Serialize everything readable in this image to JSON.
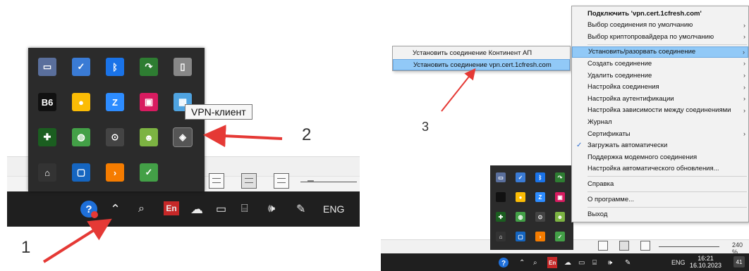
{
  "left": {
    "tray_icons": [
      {
        "name": "monitor-icon",
        "glyph": "▭",
        "color": "#5a6f9c"
      },
      {
        "name": "shield-check-icon",
        "glyph": "✓",
        "color": "#3a7bd5"
      },
      {
        "name": "bluetooth-icon",
        "glyph": "ᛒ",
        "color": "#1a73e8"
      },
      {
        "name": "green-arrow-icon",
        "glyph": "↷",
        "color": "#2e7d32"
      },
      {
        "name": "usb-drive-icon",
        "glyph": "▯",
        "color": "#888888"
      },
      {
        "name": "b6-icon",
        "glyph": "B6",
        "color": "#111111"
      },
      {
        "name": "chrome-icon",
        "glyph": "●",
        "color": "#fbbc05"
      },
      {
        "name": "zoom-icon",
        "glyph": "Z",
        "color": "#2d8cff"
      },
      {
        "name": "display-color-icon",
        "glyph": "▣",
        "color": "#d81b60"
      },
      {
        "name": "grid-window-icon",
        "glyph": "▦",
        "color": "#4fa3e0"
      },
      {
        "name": "security-shield-icon",
        "glyph": "✚",
        "color": "#1b5e20"
      },
      {
        "name": "globe-icon",
        "glyph": "◍",
        "color": "#43a047"
      },
      {
        "name": "power-circle-icon",
        "glyph": "⊙",
        "color": "#444444"
      },
      {
        "name": "frog-icon",
        "glyph": "☻",
        "color": "#7cb342"
      },
      {
        "name": "vpn-client-icon",
        "glyph": "◈",
        "color": "#9e9e9e"
      },
      {
        "name": "wifi-lock-icon",
        "glyph": "⌂",
        "color": "#333333"
      },
      {
        "name": "tv-icon",
        "glyph": "▢",
        "color": "#1565c0"
      },
      {
        "name": "play-arrow-icon",
        "glyph": "›",
        "color": "#f57c00"
      },
      {
        "name": "green-check-icon",
        "glyph": "✓",
        "color": "#43a047"
      }
    ],
    "tooltip": "VPN-клиент",
    "taskbar": {
      "lang_badge": "En",
      "lang_text": "ENG"
    },
    "callouts": {
      "one": "1",
      "two": "2"
    }
  },
  "right": {
    "callout_three": "3",
    "context_menu": [
      {
        "label": "Подключить 'vpn.cert.1cfresh.com'",
        "bold": true,
        "arrow": false,
        "check": false,
        "highlight": false,
        "sep_before": false
      },
      {
        "label": "Выбор соединения по умолчанию",
        "bold": false,
        "arrow": true,
        "check": false,
        "highlight": false,
        "sep_before": false
      },
      {
        "label": "Выбор криптопровайдера по умолчанию",
        "bold": false,
        "arrow": true,
        "check": false,
        "highlight": false,
        "sep_before": false
      },
      {
        "label": "Установить/разорвать соединение",
        "bold": false,
        "arrow": true,
        "check": false,
        "highlight": true,
        "sep_before": true
      },
      {
        "label": "Создать соединение",
        "bold": false,
        "arrow": true,
        "check": false,
        "highlight": false,
        "sep_before": false
      },
      {
        "label": "Удалить соединение",
        "bold": false,
        "arrow": true,
        "check": false,
        "highlight": false,
        "sep_before": false
      },
      {
        "label": "Настройка соединения",
        "bold": false,
        "arrow": true,
        "check": false,
        "highlight": false,
        "sep_before": false
      },
      {
        "label": "Настройка аутентификации",
        "bold": false,
        "arrow": true,
        "check": false,
        "highlight": false,
        "sep_before": false
      },
      {
        "label": "Настройка зависимости между соединениями",
        "bold": false,
        "arrow": true,
        "check": false,
        "highlight": false,
        "sep_before": false
      },
      {
        "label": "Журнал",
        "bold": false,
        "arrow": false,
        "check": false,
        "highlight": false,
        "sep_before": false
      },
      {
        "label": "Сертификаты",
        "bold": false,
        "arrow": true,
        "check": false,
        "highlight": false,
        "sep_before": false
      },
      {
        "label": "Загружать автоматически",
        "bold": false,
        "arrow": false,
        "check": true,
        "highlight": false,
        "sep_before": false
      },
      {
        "label": "Поддержка модемного соединения",
        "bold": false,
        "arrow": false,
        "check": false,
        "highlight": false,
        "sep_before": false
      },
      {
        "label": "Настройка автоматического обновления...",
        "bold": false,
        "arrow": false,
        "check": false,
        "highlight": false,
        "sep_before": false
      },
      {
        "label": "Справка",
        "bold": false,
        "arrow": false,
        "check": false,
        "highlight": false,
        "sep_before": true
      },
      {
        "label": "О программе...",
        "bold": false,
        "arrow": false,
        "check": false,
        "highlight": false,
        "sep_before": true
      },
      {
        "label": "Выход",
        "bold": false,
        "arrow": false,
        "check": false,
        "highlight": false,
        "sep_before": true
      }
    ],
    "sub_menu": [
      {
        "label": "Установить соединение Континент АП",
        "highlight": false
      },
      {
        "label": "Установить соединение vpn.cert.1cfresh.com",
        "highlight": true
      }
    ],
    "taskbar": {
      "lang_badge": "En",
      "lang_text": "ENG",
      "time": "16:21",
      "date": "16.10.2023",
      "notification_count": "41",
      "zoom_level": "240 %"
    }
  },
  "colors": {
    "taskbar": "#1f1f1f",
    "tray": "#2b2b2b",
    "menu_highlight": "#91c9f7",
    "arrow": "#e53935"
  }
}
